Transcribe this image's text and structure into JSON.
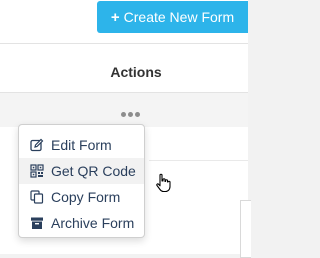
{
  "header": {
    "create_label": "Create New Form"
  },
  "table": {
    "actions_header": "Actions"
  },
  "menu": {
    "items": [
      {
        "label": "Edit Form",
        "icon": "edit-icon"
      },
      {
        "label": "Get QR Code",
        "icon": "qr-code-icon"
      },
      {
        "label": "Copy Form",
        "icon": "copy-icon"
      },
      {
        "label": "Archive Form",
        "icon": "archive-icon"
      }
    ]
  },
  "colors": {
    "accent": "#2db4ea",
    "menu_text": "#2a3f5c"
  }
}
